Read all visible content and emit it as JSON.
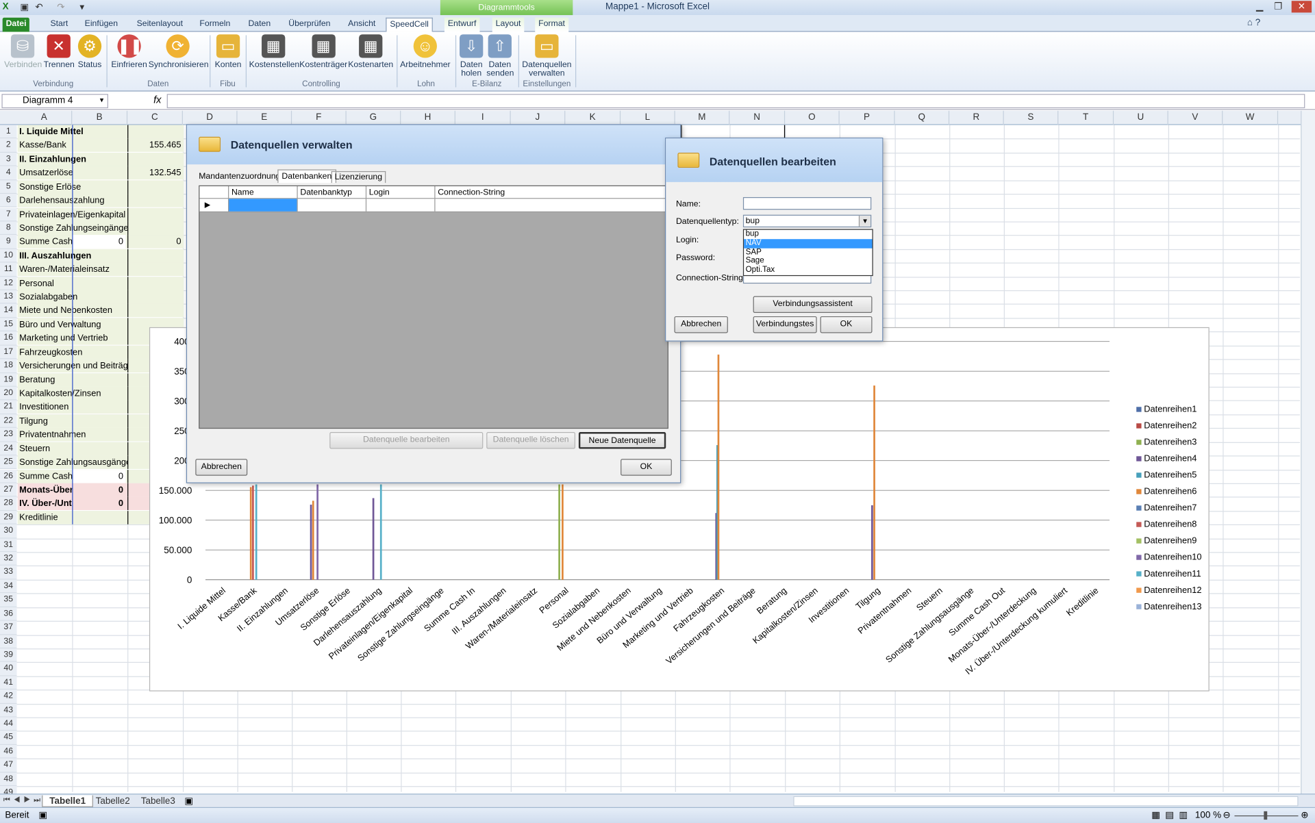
{
  "window": {
    "title": "Mappe1  -  Microsoft Excel",
    "context_header": "Diagrammtools"
  },
  "tabs": [
    "Datei",
    "Start",
    "Einfügen",
    "Seitenlayout",
    "Formeln",
    "Daten",
    "Überprüfen",
    "Ansicht",
    "SpeedCell",
    "Entwurf",
    "Layout",
    "Format"
  ],
  "ribbon": {
    "buttons": [
      "Verbinden",
      "Trennen",
      "Status",
      "Einfrieren",
      "Synchronisieren",
      "Konten",
      "Kostenstellen",
      "Kostenträger",
      "Kostenarten",
      "Arbeitnehmer",
      "Daten holen",
      "Daten senden",
      "Datenquellen verwalten"
    ],
    "groups": [
      "Verbindung",
      "Daten",
      "Fibu",
      "Controlling",
      "Lohn",
      "E-Bilanz",
      "Einstellungen"
    ]
  },
  "formula_bar": {
    "name_box": "Diagramm 4",
    "fx": "fx",
    "content": ""
  },
  "columns": [
    "A",
    "B",
    "C",
    "D",
    "E",
    "F",
    "G",
    "H",
    "I",
    "J",
    "K",
    "L",
    "M",
    "N",
    "O",
    "P",
    "Q",
    "R",
    "S",
    "T",
    "U",
    "V",
    "W"
  ],
  "rows": [
    {
      "a": "I. Liquide Mittel",
      "c": "",
      "style": "bold"
    },
    {
      "a": "Kasse/Bank",
      "c": "155.465"
    },
    {
      "a": "II. Einzahlungen",
      "c": "",
      "style": "bold"
    },
    {
      "a": "Umsatzerlöse",
      "c": "132.545"
    },
    {
      "a": "Sonstige Erlöse",
      "c": ""
    },
    {
      "a": "Darlehensauszahlung",
      "c": ""
    },
    {
      "a": "Privateinlagen/Eigenkapital",
      "c": ""
    },
    {
      "a": "Sonstige Zahlungseingänge",
      "c": ""
    },
    {
      "a": "Summe Cash I",
      "b": "0",
      "c": "0"
    },
    {
      "a": "III. Auszahlungen",
      "c": "",
      "style": "bold"
    },
    {
      "a": "Waren-/Materialeinsatz",
      "c": ""
    },
    {
      "a": "Personal",
      "c": ""
    },
    {
      "a": "Sozialabgaben",
      "c": ""
    },
    {
      "a": "Miete und Nebenkosten",
      "c": ""
    },
    {
      "a": "Büro und Verwaltung",
      "c": ""
    },
    {
      "a": "Marketing und Vertrieb",
      "c": ""
    },
    {
      "a": "Fahrzeugkosten",
      "c": ""
    },
    {
      "a": "Versicherungen und Beiträge",
      "c": ""
    },
    {
      "a": "Beratung",
      "c": ""
    },
    {
      "a": "Kapitalkosten/Zinsen",
      "c": ""
    },
    {
      "a": "Investitionen",
      "c": ""
    },
    {
      "a": "Tilgung",
      "c": ""
    },
    {
      "a": "Privatentnahmen",
      "c": ""
    },
    {
      "a": "Steuern",
      "c": ""
    },
    {
      "a": "Sonstige Zahlungsausgänge",
      "c": ""
    },
    {
      "a": "Summe Cash O",
      "b": "0",
      "c": ""
    },
    {
      "a": "Monats-Über-",
      "b": "0",
      "c": "",
      "style": "boldpink"
    },
    {
      "a": "IV. Über-/Unte",
      "b": "0",
      "c": "",
      "style": "boldpink"
    },
    {
      "a": "Kreditlinie",
      "c": ""
    }
  ],
  "dialog_manage": {
    "title": "Datenquellen verwalten",
    "tabs": [
      "Mandantenzuordnung",
      "Datenbanken",
      "Lizenzierung"
    ],
    "columns": [
      "Name",
      "Datenbanktyp",
      "Login",
      "Connection-String"
    ],
    "buttons": {
      "edit": "Datenquelle bearbeiten",
      "delete": "Datenquelle löschen",
      "new": "Neue Datenquelle",
      "cancel": "Abbrechen",
      "ok": "OK"
    }
  },
  "dialog_edit": {
    "title": "Datenquellen bearbeiten",
    "labels": {
      "name": "Name:",
      "type": "Datenquellentyp:",
      "login": "Login:",
      "password": "Password:",
      "conn": "Connection-String:"
    },
    "type_value": "bup",
    "options": [
      "bup",
      "NAV",
      "SAP",
      "Sage",
      "Opti.Tax"
    ],
    "selected_option": "NAV",
    "buttons": {
      "assistant": "Verbindungsassistent",
      "cancel": "Abbrechen",
      "test": "Verbindungstes",
      "ok": "OK"
    }
  },
  "chart_data": {
    "type": "bar",
    "y_ticks": [
      "0",
      "50.000",
      "100.000",
      "150.000",
      "200.",
      "250.",
      "300.",
      "350.",
      "400."
    ],
    "ylim": [
      0,
      400000
    ],
    "categories": [
      "I. Liquide Mittel",
      "Kasse/Bank",
      "II. Einzahlungen",
      "Umsatzerlöse",
      "Sonstige Erlöse",
      "Darlehensauszahlung",
      "Privateinlagen/Eigenkapital",
      "Sonstige Zahlungseingänge",
      "Summe Cash In",
      "III. Auszahlungen",
      "Waren-/Materialeinsatz",
      "Personal",
      "Sozialabgaben",
      "Miete und Nebenkosten",
      "Büro und Verwaltung",
      "Marketing und Vertrieb",
      "Fahrzeugkosten",
      "Versicherungen und Beiträge",
      "Beratung",
      "Kapitalkosten/Zinsen",
      "Investitionen",
      "Tilgung",
      "Privatentnahmen",
      "Steuern",
      "Sonstige Zahlungsausgänge",
      "Summe Cash Out",
      "Monats-Über-/Unterdeckung",
      "IV. Über-/Unterdeckung kumuliert",
      "Kreditlinie"
    ],
    "legend": [
      "Datenreihen1",
      "Datenreihen2",
      "Datenreihen3",
      "Datenreihen4",
      "Datenreihen5",
      "Datenreihen6",
      "Datenreihen7",
      "Datenreihen8",
      "Datenreihen9",
      "Datenreihen10",
      "Datenreihen11",
      "Datenreihen12",
      "Datenreihen13"
    ],
    "legend_position": "right",
    "colors": [
      "#4f6fa8",
      "#b84a45",
      "#8fb050",
      "#6f5797",
      "#47a0bb",
      "#e0873a",
      "#5a7fb4",
      "#c45a56",
      "#a3c063",
      "#8068a8",
      "#56b0c8",
      "#f0994c",
      "#9ab2d8"
    ],
    "bars": [
      {
        "cat": 1,
        "series": 5,
        "value": 155465
      },
      {
        "cat": 1,
        "series": 10,
        "value": 160000
      },
      {
        "cat": 1,
        "series": 7,
        "value": 158000
      },
      {
        "cat": 3,
        "series": 5,
        "value": 132545
      },
      {
        "cat": 3,
        "series": 3,
        "value": 126000
      },
      {
        "cat": 3,
        "series": 9,
        "value": 160000
      },
      {
        "cat": 5,
        "series": 3,
        "value": 137000
      },
      {
        "cat": 5,
        "series": 10,
        "value": 160000
      },
      {
        "cat": 11,
        "series": 2,
        "value": 160000
      },
      {
        "cat": 11,
        "series": 5,
        "value": 160000
      },
      {
        "cat": 16,
        "series": 3,
        "value": 112000
      },
      {
        "cat": 16,
        "series": 4,
        "value": 226000
      },
      {
        "cat": 16,
        "series": 5,
        "value": 378000
      },
      {
        "cat": 21,
        "series": 3,
        "value": 125000
      },
      {
        "cat": 21,
        "series": 5,
        "value": 326000
      }
    ]
  },
  "sheets": [
    "Tabelle1",
    "Tabelle2",
    "Tabelle3"
  ],
  "status": {
    "ready": "Bereit",
    "zoom": "100 %"
  }
}
